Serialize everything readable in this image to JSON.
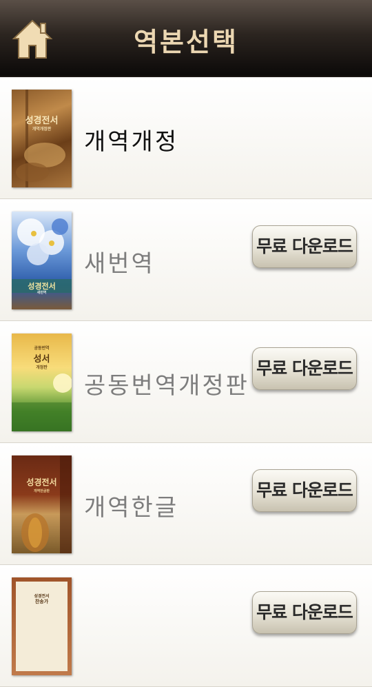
{
  "header": {
    "title": "역본선택",
    "home_icon": "home-icon"
  },
  "download_label": "무료 다운로드",
  "versions": [
    {
      "name": "개역개정",
      "installed": true,
      "cover_text": "성경전서",
      "cover_sub": "개역개정판"
    },
    {
      "name": "새번역",
      "installed": false,
      "cover_text": "성경전서",
      "cover_sub": "새번역"
    },
    {
      "name": "공동번역개정판",
      "installed": false,
      "cover_text": "성서",
      "cover_top": "공동번역",
      "cover_sub": "개정판"
    },
    {
      "name": "개역한글",
      "installed": false,
      "cover_text": "성경전서",
      "cover_sub": "개역한글판"
    },
    {
      "name": "",
      "installed": false,
      "cover_text": "찬송가",
      "cover_sub": "",
      "cover_top": "성경전서"
    }
  ],
  "colors": {
    "header_text": "#ecd7b2",
    "installed_text": "#111111",
    "available_text": "#7d7d7d"
  }
}
